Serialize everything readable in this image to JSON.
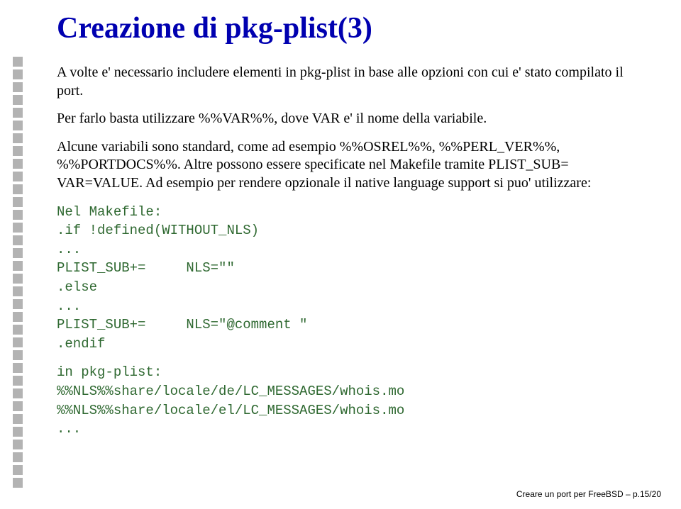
{
  "title": "Creazione di pkg-plist(3)",
  "paragraphs": {
    "p1": "A volte e' necessario includere elementi in pkg-plist in base alle opzioni con cui e' stato compilato il port.",
    "p2": "Per farlo basta utilizzare %%VAR%%, dove VAR e' il nome della variabile.",
    "p3": "Alcune variabili sono standard, come ad esempio %%OSREL%%, %%PERL_VER%%, %%PORTDOCS%%. Altre possono essere specificate nel Makefile tramite PLIST_SUB= VAR=VALUE. Ad esempio per rendere opzionale il native language support si puo' utilizzare:"
  },
  "code1": "Nel Makefile:\n.if !defined(WITHOUT_NLS)\n...\nPLIST_SUB+=     NLS=\"\"\n.else\n...\nPLIST_SUB+=     NLS=\"@comment \"\n.endif",
  "code2": "in pkg-plist:\n%%NLS%%share/locale/de/LC_MESSAGES/whois.mo\n%%NLS%%share/locale/el/LC_MESSAGES/whois.mo\n...",
  "footer": "Creare un port per FreeBSD – p.15/20"
}
